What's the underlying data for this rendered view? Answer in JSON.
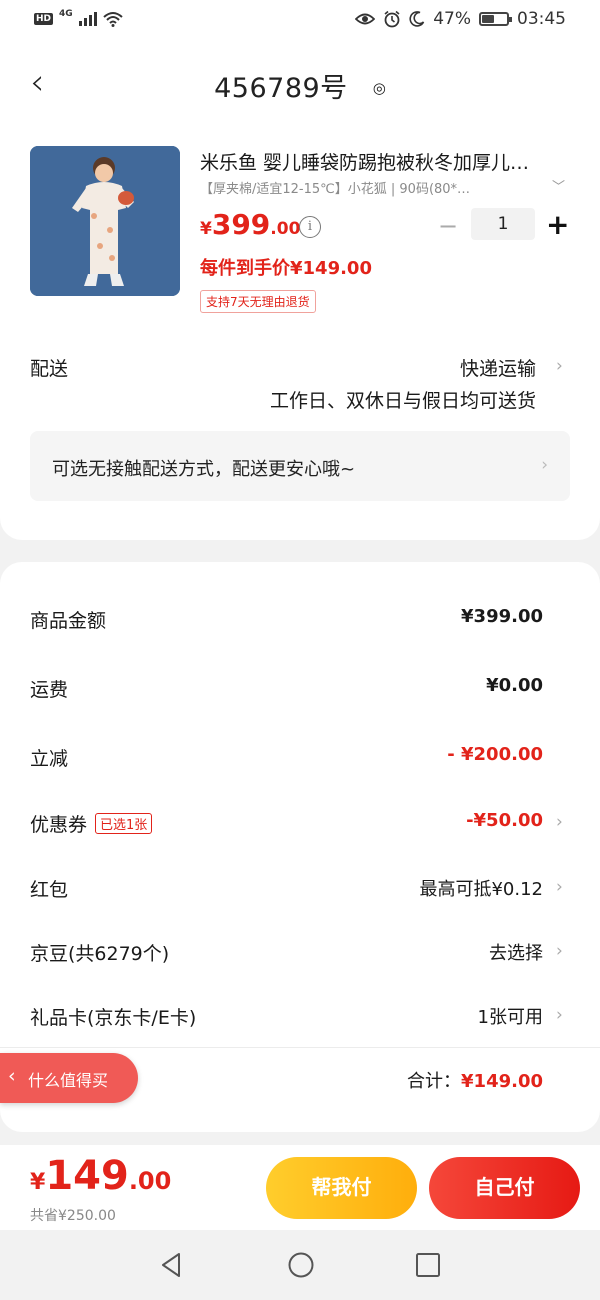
{
  "status_bar": {
    "network": "4G",
    "battery": "47%",
    "battery_level": 0.47,
    "time": "03:45"
  },
  "header": {
    "title": "456789号"
  },
  "product": {
    "title": "米乐鱼 婴儿睡袋防踢抱被秋冬加厚儿…",
    "spec": "【厚夹棉/适宜12-15℃】小花狐 | 90码(80*…",
    "price_currency": "¥",
    "price_int": "399",
    "price_dec": ".00",
    "quantity": "1",
    "unit_price": "每件到手价¥149.00",
    "return_badge": "支持7天无理由退货"
  },
  "delivery": {
    "label": "配送",
    "method": "快递运输",
    "note": "工作日、双休日与假日均可送货",
    "contactless": "可选无接触配送方式，配送更安心哦~"
  },
  "summary": {
    "rows": [
      {
        "label": "商品金额",
        "value": "¥399.00"
      },
      {
        "label": "运费",
        "value": "¥0.00"
      },
      {
        "label": "立减",
        "value": "- ¥200.00"
      },
      {
        "label": "优惠券",
        "badge": "已选1张",
        "value": "-¥50.00"
      },
      {
        "label": "红包",
        "value": "最高可抵¥0.12"
      },
      {
        "label": "京豆(共6279个)",
        "value": "去选择"
      },
      {
        "label": "礼品卡(京东卡/E卡)",
        "value": "1张可用"
      }
    ],
    "total_label": "合计：",
    "total_value": "¥149.00"
  },
  "floating": {
    "label": "什么值得买"
  },
  "bottom_bar": {
    "currency": "¥",
    "price_int": "149",
    "price_dec": ".00",
    "saved": "共省¥250.00",
    "help_pay": "帮我付",
    "self_pay": "自己付"
  },
  "colors": {
    "accent_red": "#e2231a",
    "help_button": "#ffbd1c",
    "self_button": "#ea2b22"
  }
}
